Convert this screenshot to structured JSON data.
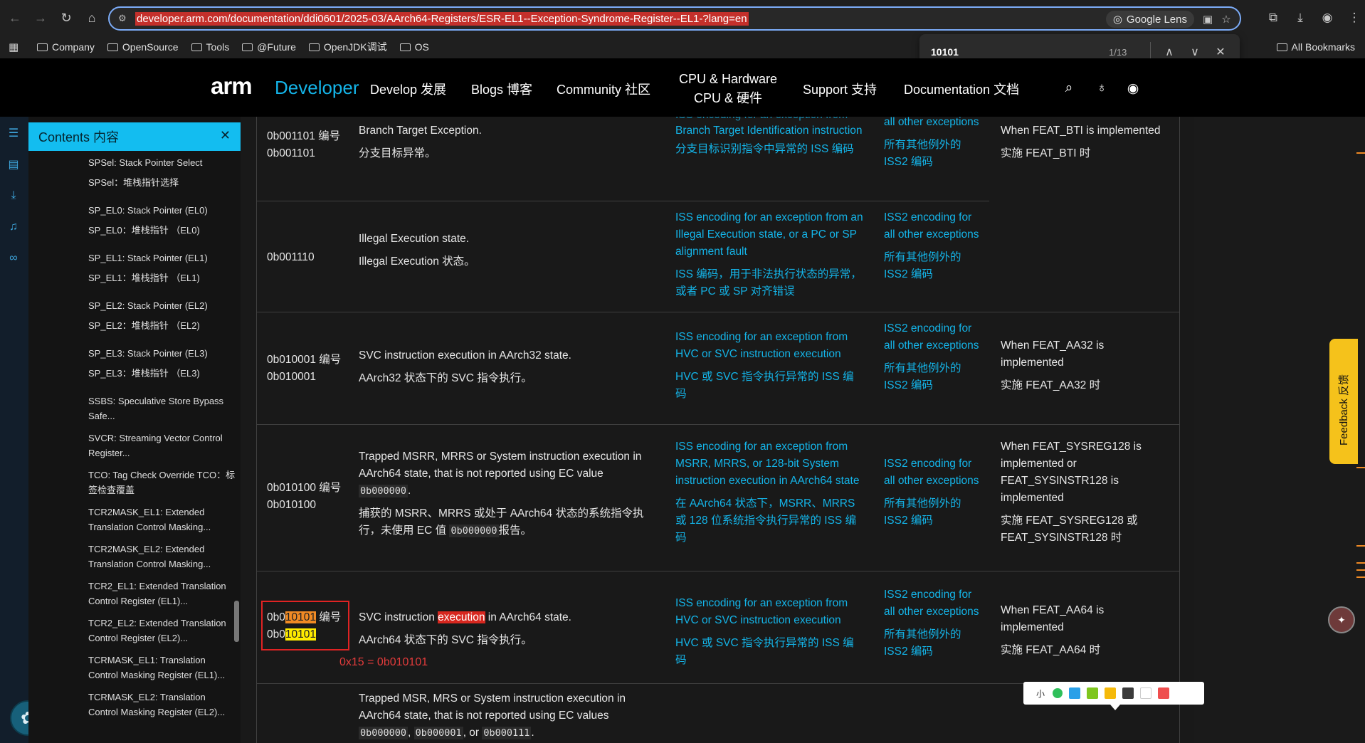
{
  "browser": {
    "url": "developer.arm.com/documentation/ddi0601/2025-03/AArch64-Registers/ESR-EL1--Exception-Syndrome-Register--EL1-?lang=en",
    "lens_label": "Google Lens"
  },
  "bookmarks": {
    "items": [
      "Company",
      "OpenSource",
      "Tools",
      "@Future",
      "OpenJDK调试",
      "OS"
    ],
    "all_label": "All Bookmarks"
  },
  "find": {
    "query": "10101",
    "count": "1/13"
  },
  "header": {
    "logo": "arm",
    "developer": "Developer",
    "nav": {
      "develop": "Develop 发展",
      "blogs": "Blogs 博客",
      "community": "Community 社区",
      "cpu_line1": "CPU & Hardware",
      "cpu_line2": "CPU & 硬件",
      "support": "Support 支持",
      "documentation": "Documentation 文档"
    }
  },
  "toc": {
    "title": "Contents 内容",
    "items": [
      {
        "en": "SPSel: Stack Pointer Select",
        "zh": "SPSel：堆栈指针选择"
      },
      {
        "en": "SP_EL0: Stack Pointer (EL0)",
        "zh": "SP_EL0：堆栈指针 （EL0)"
      },
      {
        "en": "SP_EL1: Stack Pointer (EL1)",
        "zh": "SP_EL1：堆栈指针 （EL1)"
      },
      {
        "en": "SP_EL2: Stack Pointer (EL2)",
        "zh": "SP_EL2：堆栈指针 （EL2)"
      },
      {
        "en": "SP_EL3: Stack Pointer (EL3)",
        "zh": "SP_EL3：堆栈指针 （EL3)"
      },
      {
        "en": "SSBS: Speculative Store Bypass Safe...",
        "zh": ""
      },
      {
        "en": "SVCR: Streaming Vector Control Register...",
        "zh": ""
      },
      {
        "en": "TCO: Tag Check Override  TCO：标签检查覆盖",
        "zh": ""
      },
      {
        "en": "TCR2MASK_EL1: Extended Translation Control Masking...",
        "zh": ""
      },
      {
        "en": "TCR2MASK_EL2: Extended Translation Control Masking...",
        "zh": ""
      },
      {
        "en": "TCR2_EL1: Extended Translation Control Register (EL1)...",
        "zh": ""
      },
      {
        "en": "TCR2_EL2: Extended Translation Control Register (EL2)...",
        "zh": ""
      },
      {
        "en": "TCRMASK_EL1: Translation Control Masking Register (EL1)...",
        "zh": ""
      },
      {
        "en": "TCRMASK_EL2: Translation Control Masking Register (EL2)...",
        "zh": ""
      }
    ]
  },
  "table": {
    "top_cut_iss": "ISS encoding for an exception from",
    "rows": [
      {
        "ec_a": "0b001101 编号 0b001101",
        "desc_en": "Branch Target Exception.",
        "desc_zh": "分支目标异常。",
        "iss_en": "Branch Target Identification instruction",
        "iss_zh": "分支目标识别指令中异常的 ISS 编码",
        "iss2_en": "all other exceptions",
        "iss2_zh": "所有其他例外的 ISS2 编码",
        "cond_en": "When FEAT_BTI is implemented",
        "cond_zh": "实施 FEAT_BTI 时"
      },
      {
        "ec_a": "0b001110",
        "desc_en": "Illegal Execution state.",
        "desc_zh": "Illegal Execution 状态。",
        "iss_en": "ISS encoding for an exception from an Illegal Execution state, or a PC or SP alignment fault",
        "iss_zh": "ISS 编码，用于非法执行状态的异常，或者 PC 或 SP 对齐错误",
        "iss2_en": "ISS2 encoding for all other exceptions",
        "iss2_zh": "所有其他例外的 ISS2 编码",
        "cond_en": "",
        "cond_zh": ""
      },
      {
        "ec_a": "0b010001 编号 0b010001",
        "desc_en": "SVC instruction execution in AArch32 state.",
        "desc_zh": "AArch32 状态下的 SVC 指令执行。",
        "iss_en": "ISS encoding for an exception from HVC or SVC instruction execution",
        "iss_zh": "HVC 或 SVC 指令执行异常的 ISS 编码",
        "iss2_en": "ISS2 encoding for all other exceptions",
        "iss2_zh": "所有其他例外的 ISS2 编码",
        "cond_en": "When FEAT_AA32 is implemented",
        "cond_zh": "实施 FEAT_AA32 时"
      },
      {
        "ec_a": "0b010100 编号 0b010100",
        "desc_en1": "Trapped MSRR, MRRS or System instruction execution in AArch64 state, that is not reported using EC value",
        "desc_code1": "0b000000",
        "desc_zh1": "捕获的 MSRR、MRRS 或处于 AArch64 状态的系统指令执行，未使用 EC 值",
        "desc_code2": "0b000000",
        "desc_zh2": "报告。",
        "iss_en": "ISS encoding for an exception from MSRR, MRRS, or 128-bit System instruction execution in AArch64 state",
        "iss_zh": "在 AArch64 状态下，MSRR、MRRS 或 128 位系统指令执行异常的 ISS 编码",
        "iss2_en": "ISS2 encoding for all other exceptions",
        "iss2_zh": "所有其他例外的 ISS2 编码",
        "cond_en": "When FEAT_SYSREG128 is implemented or FEAT_SYSINSTR128 is implemented",
        "cond_zh": "实施 FEAT_SYSREG128 或 FEAT_SYSINSTR128 时"
      },
      {
        "ec_pre": "0b0",
        "ec_hl": "10101",
        "ec_mid": " 编号 0b0",
        "ec_hl2": "10101",
        "desc_pre": "SVC instruction ",
        "desc_hl": "execution",
        "desc_post": " in AArch64 state.",
        "desc_zh": "AArch64 状态下的 SVC 指令执行。",
        "annotation": "0x15 = 0b010101",
        "iss_en": "ISS encoding for an exception from HVC or SVC instruction execution",
        "iss_zh": "HVC 或 SVC 指令执行异常的 ISS 编码",
        "iss2_en": "ISS2 encoding for all other exceptions",
        "iss2_zh": "所有其他例外的 ISS2 编码",
        "cond_en": "When FEAT_AA64 is implemented",
        "cond_zh": "实施 FEAT_AA64 时"
      },
      {
        "desc_en": "Trapped MSR, MRS or System instruction execution in AArch64 state, that is not reported using EC values",
        "code_a": "0b000000",
        "code_b": "0b000001",
        "code_c": "0b000111",
        "sep1": ", ",
        "sep2": ", or ",
        "sep3": "."
      }
    ]
  },
  "feedback": {
    "label": "Feedback 反馈"
  },
  "palette": {
    "label": "小",
    "colors": [
      "#2aa0e8",
      "#7ec61e",
      "#f5b90a",
      "#3b3b3b",
      "#ffffff",
      "#ef4e4e"
    ]
  }
}
